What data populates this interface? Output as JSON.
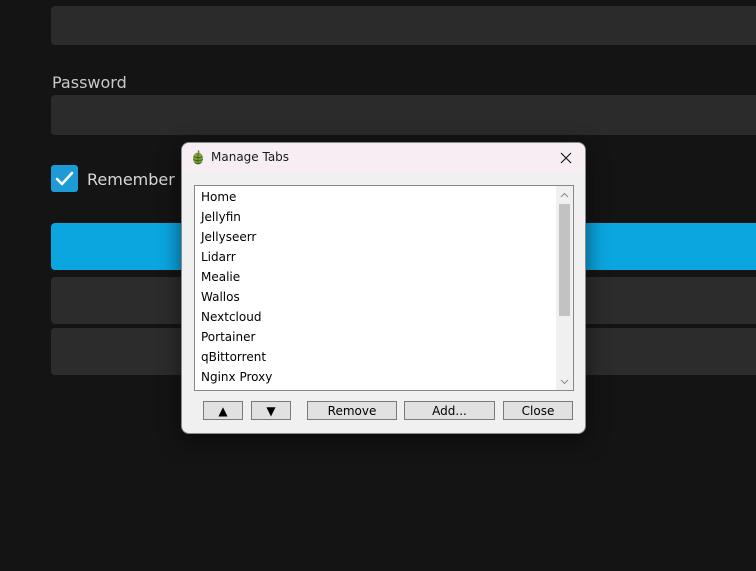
{
  "background": {
    "password_label": "Password",
    "remember_label": "Remember M",
    "accent_color": "#0ba6e0"
  },
  "dialog": {
    "title": "Manage Tabs",
    "app_icon": "hop-leaf-icon",
    "tabs": [
      "Home",
      "Jellyfin",
      "Jellyseerr",
      "Lidarr",
      "Mealie",
      "Wallos",
      "Nextcloud",
      "Portainer",
      "qBittorrent",
      "Nginx Proxy"
    ],
    "buttons": {
      "move_up": "▲",
      "move_down": "▼",
      "remove": "Remove",
      "add": "Add...",
      "close": "Close"
    }
  }
}
